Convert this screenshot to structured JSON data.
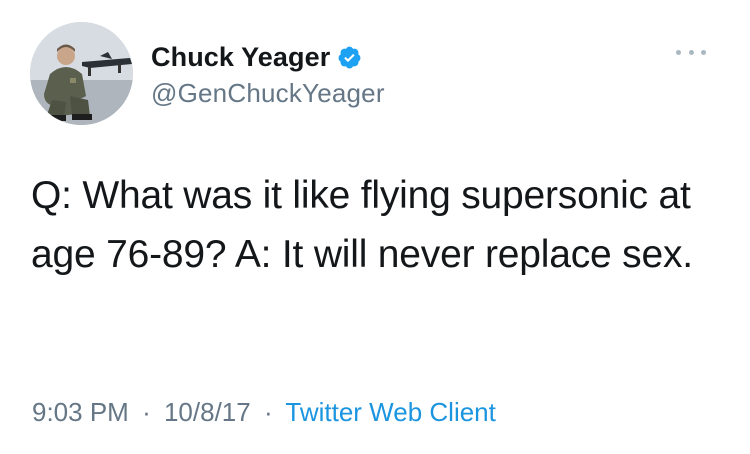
{
  "author": {
    "name": "Chuck Yeager",
    "handle": "@GenChuckYeager",
    "verified": true,
    "avatar_icon": "profile-photo-pilot-with-jet"
  },
  "more_icon": "ellipsis-icon",
  "tweet": {
    "text": "Q: What was it like flying supersonic at age 76-89? A: It will never replace sex."
  },
  "meta": {
    "time": "9:03 PM",
    "separator": "·",
    "date": "10/8/17",
    "client": "Twitter Web Client"
  },
  "colors": {
    "text": "#14171a",
    "secondary": "#657786",
    "link": "#1b95e0",
    "verified": "#1da1f2"
  }
}
